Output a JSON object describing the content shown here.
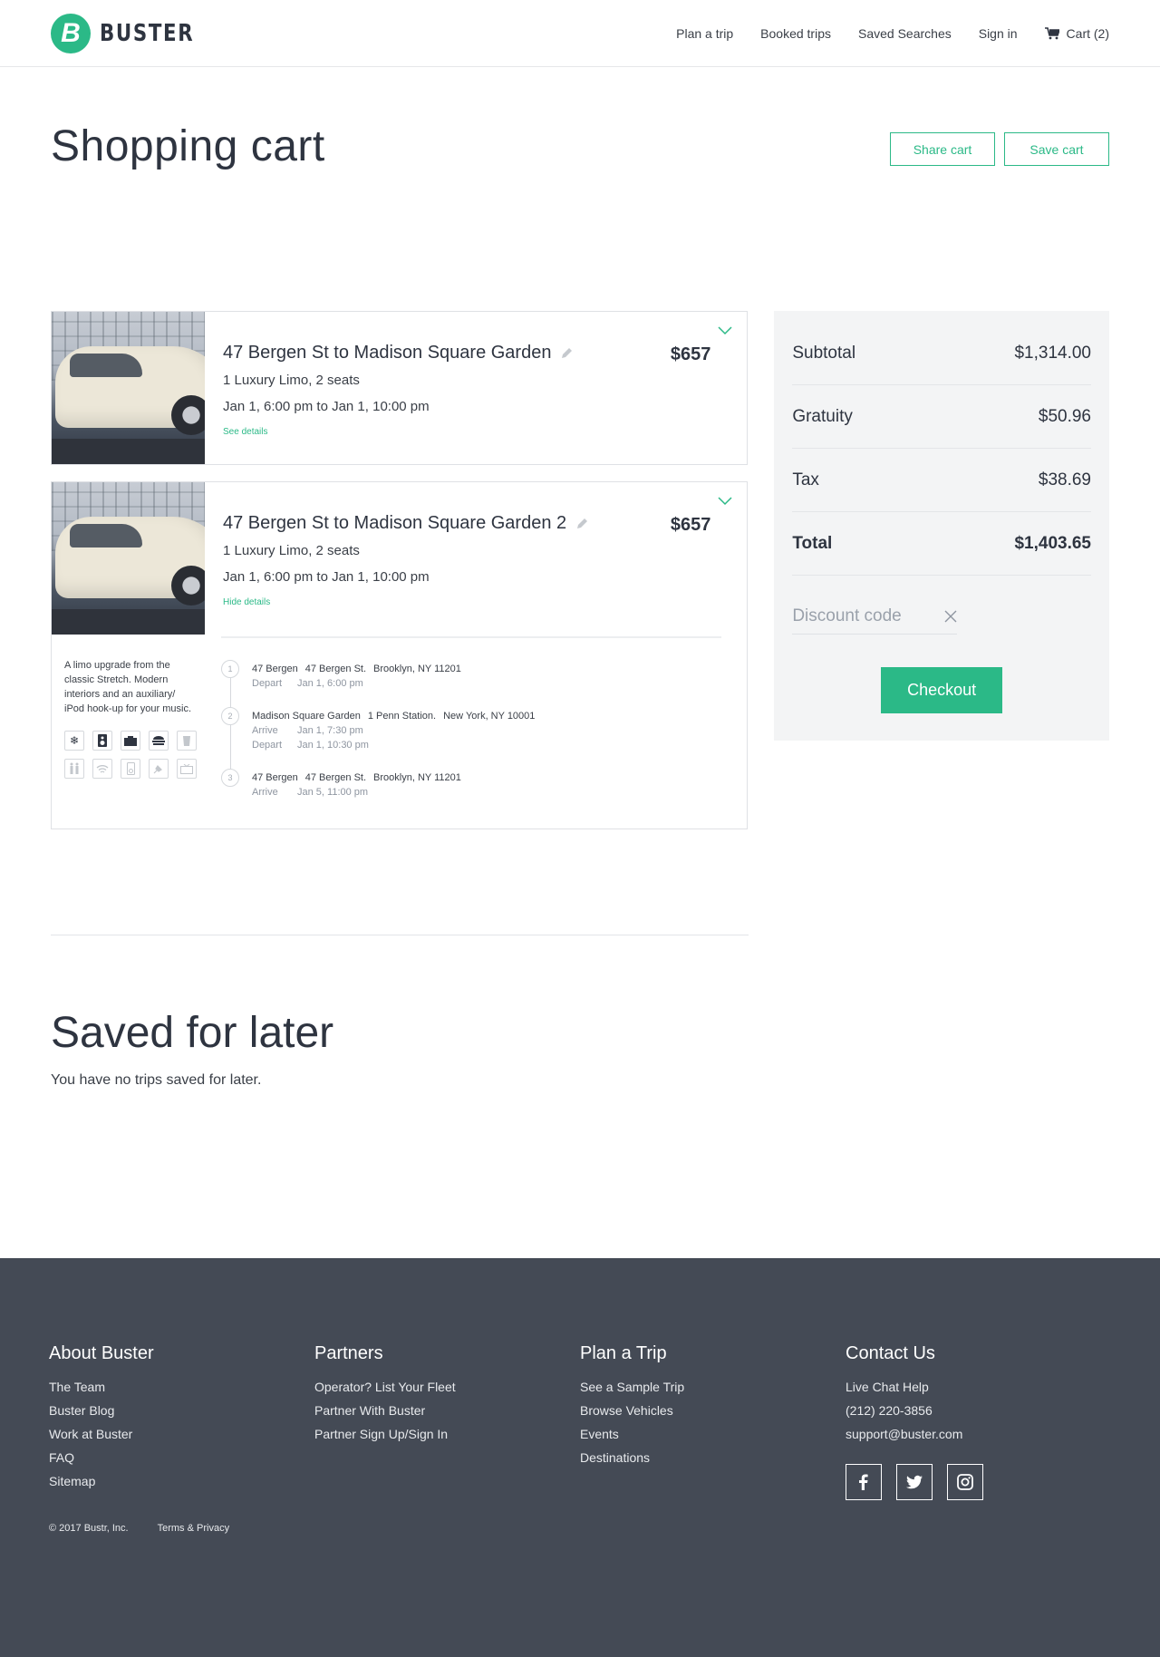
{
  "header": {
    "logo_mark": "B",
    "brand": "BUSTER",
    "nav": [
      "Plan a trip",
      "Booked trips",
      "Saved Searches",
      "Sign in"
    ],
    "cart_label": "Cart (2)"
  },
  "page": {
    "title": "Shopping cart",
    "share_label": "Share cart",
    "save_label": "Save cart"
  },
  "trips": [
    {
      "title": "47 Bergen St to Madison Square Garden",
      "price": "$657",
      "vehicle": "1 Luxury Limo, 2 seats",
      "dates": "Jan 1, 6:00 pm to Jan 1, 10:00 pm",
      "details_link": "See details"
    },
    {
      "title": "47 Bergen St to Madison Square Garden 2",
      "price": "$657",
      "vehicle": "1 Luxury Limo, 2 seats",
      "dates": "Jan 1, 6:00 pm to Jan 1, 10:00 pm",
      "details_link": "Hide details",
      "description": "A limo upgrade from the classic Stretch. Modern interiors and an auxiliary/ iPod hook-up for your music.",
      "stops": [
        {
          "num": "1",
          "name": "47 Bergen",
          "address": "47 Bergen St.",
          "city": "Brooklyn, NY 11201",
          "times": [
            {
              "label": "Depart",
              "value": "Jan 1, 6:00 pm"
            }
          ]
        },
        {
          "num": "2",
          "name": "Madison Square Garden",
          "address": "1 Penn Station.",
          "city": "New York, NY 10001",
          "times": [
            {
              "label": "Arrive",
              "value": "Jan 1, 7:30 pm"
            },
            {
              "label": "Depart",
              "value": "Jan 1, 10:30 pm"
            }
          ]
        },
        {
          "num": "3",
          "name": "47 Bergen",
          "address": "47 Bergen St.",
          "city": "Brooklyn, NY 11201",
          "times": [
            {
              "label": "Arrive",
              "value": "Jan 5, 11:00 pm"
            }
          ]
        }
      ]
    }
  ],
  "summary": {
    "subtotal_label": "Subtotal",
    "subtotal": "$1,314.00",
    "gratuity_label": "Gratuity",
    "gratuity": "$50.96",
    "tax_label": "Tax",
    "tax": "$38.69",
    "total_label": "Total",
    "total": "$1,403.65",
    "discount_label": "Discount code",
    "checkout_label": "Checkout"
  },
  "saved": {
    "title": "Saved for later",
    "empty": "You have no trips saved for later."
  },
  "footer": {
    "cols": [
      {
        "heading": "About Buster",
        "links": [
          "The Team",
          "Buster Blog",
          "Work at Buster",
          "FAQ",
          "Sitemap"
        ]
      },
      {
        "heading": "Partners",
        "links": [
          "Operator? List Your Fleet",
          "Partner With Buster",
          "Partner Sign Up/Sign In"
        ]
      },
      {
        "heading": "Plan a Trip",
        "links": [
          "See a Sample Trip",
          "Browse Vehicles",
          "Events",
          "Destinations"
        ]
      },
      {
        "heading": "Contact Us",
        "links": [
          "Live Chat Help",
          "(212) 220-3856",
          "support@buster.com"
        ]
      }
    ],
    "copyright": "© 2017 Bustr, Inc.",
    "terms": "Terms & Privacy"
  },
  "icons": {
    "amenities": [
      "snowflake-icon",
      "speaker-icon",
      "tv-icon",
      "bar-icon",
      "cup-icon",
      "restroom-icon",
      "wifi-icon",
      "ipod-icon",
      "charger-icon",
      "screen-icon"
    ],
    "socials": [
      "facebook-icon",
      "twitter-icon",
      "instagram-icon"
    ]
  },
  "colors": {
    "accent": "#2bb987",
    "footer_bg": "#444a55",
    "summary_bg": "#f3f4f5"
  }
}
